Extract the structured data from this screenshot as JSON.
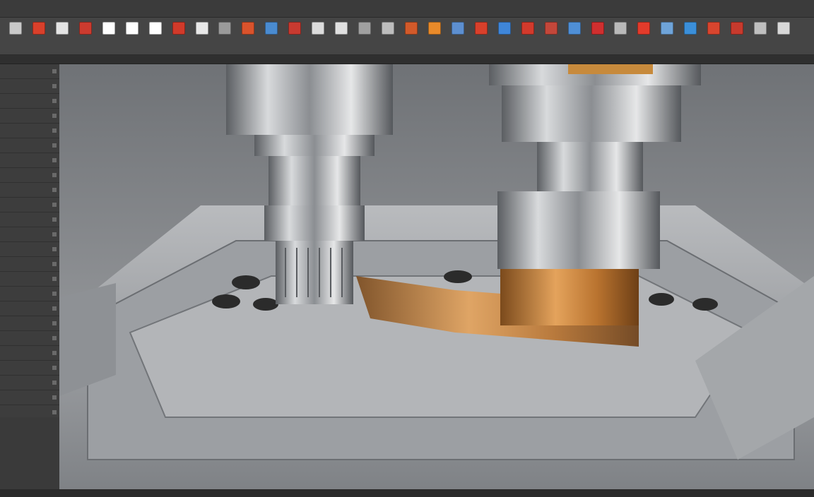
{
  "menubar": {
    "items": [
      "",
      "",
      "",
      "",
      "",
      "",
      "",
      "",
      "",
      "",
      "",
      "",
      "",
      ""
    ]
  },
  "toolbar": {
    "tools": [
      {
        "name": "tool-1",
        "color": "#c9c9c9"
      },
      {
        "name": "tool-2",
        "color": "#d9402b"
      },
      {
        "name": "tool-3",
        "color": "#e4e4e4"
      },
      {
        "name": "tool-4",
        "color": "#cc3b2f"
      },
      {
        "name": "tool-5",
        "color": "#ffffff"
      },
      {
        "name": "tool-6",
        "color": "#ffffff"
      },
      {
        "name": "tool-7",
        "color": "#ffffff"
      },
      {
        "name": "tool-8",
        "color": "#d13a2a"
      },
      {
        "name": "tool-9",
        "color": "#e8e8e8"
      },
      {
        "name": "tool-10",
        "color": "#9a9a9a"
      },
      {
        "name": "tool-11",
        "color": "#d9532c"
      },
      {
        "name": "tool-12",
        "color": "#4a8bd0"
      },
      {
        "name": "tool-13",
        "color": "#c83a30"
      },
      {
        "name": "tool-14",
        "color": "#dcdcdc"
      },
      {
        "name": "tool-15",
        "color": "#e0e0e0"
      },
      {
        "name": "tool-16",
        "color": "#a0a0a0"
      },
      {
        "name": "tool-17",
        "color": "#bdbdbd"
      },
      {
        "name": "tool-18",
        "color": "#d25a2a"
      },
      {
        "name": "tool-19",
        "color": "#e98a2a"
      },
      {
        "name": "tool-20",
        "color": "#5d8fd0"
      },
      {
        "name": "tool-21",
        "color": "#d9402b"
      },
      {
        "name": "tool-22",
        "color": "#3f86d9"
      },
      {
        "name": "tool-23",
        "color": "#d23a2c"
      },
      {
        "name": "tool-24",
        "color": "#c3473a"
      },
      {
        "name": "tool-25",
        "color": "#4f8fd6"
      },
      {
        "name": "tool-26",
        "color": "#cf2f2f"
      },
      {
        "name": "tool-27",
        "color": "#b9b9b9"
      },
      {
        "name": "tool-28",
        "color": "#e33b2b"
      },
      {
        "name": "tool-29",
        "color": "#6fa4d9"
      },
      {
        "name": "tool-30",
        "color": "#3b8fd9"
      },
      {
        "name": "tool-31",
        "color": "#d8452e"
      },
      {
        "name": "tool-32",
        "color": "#c73a2d"
      },
      {
        "name": "tool-33",
        "color": "#bfbfbf"
      },
      {
        "name": "tool-34",
        "color": "#d8d8d8"
      }
    ]
  },
  "colors": {
    "accent_orange": "#e98a2a",
    "accent_blue": "#3b8fd9",
    "accent_red": "#d9402b"
  }
}
